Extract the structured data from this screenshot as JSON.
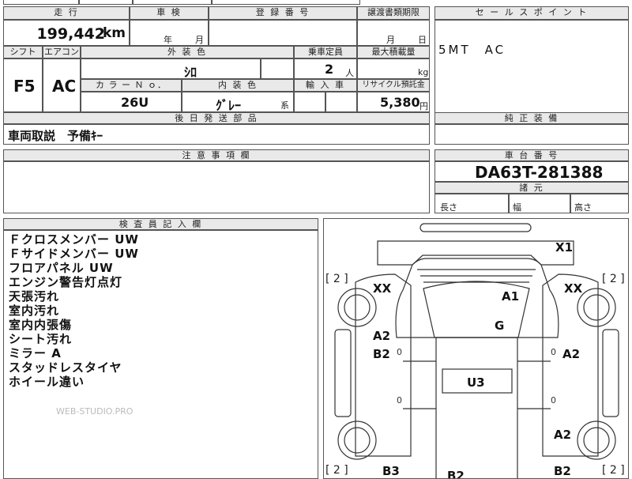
{
  "top_strip": {
    "partial_text": "…"
  },
  "mileage": {
    "header": "走 行",
    "value": "199,442",
    "unit": "km"
  },
  "inspection": {
    "header": "車 検",
    "year_unit": "年",
    "month_unit": "月"
  },
  "registration": {
    "header": "登 録 番 号",
    "value": ""
  },
  "transfer_deadline": {
    "header": "譲渡書類期限",
    "month_unit": "月",
    "day_unit": "日"
  },
  "sales_point": {
    "header": "セ ー ル ス ポ イ ン ト",
    "text": "5MT　AC"
  },
  "shift": {
    "header": "シフト",
    "value": "F5"
  },
  "aircon": {
    "header": "エアコン",
    "value": "AC"
  },
  "exterior": {
    "header": "外 装 色",
    "value": "ｼﾛ"
  },
  "capacity": {
    "header": "乗車定員",
    "value": "2",
    "unit": "人"
  },
  "max_load": {
    "header": "最大積載量",
    "value": "",
    "unit": "kg"
  },
  "color_no": {
    "header": "カ ラ ー Ｎ ｏ．",
    "value": "26U"
  },
  "interior": {
    "header": "内 装 色",
    "value": "ｸﾞﾚｰ",
    "suffix": "系"
  },
  "import": {
    "header": "輸 入 車",
    "value": ""
  },
  "recycle": {
    "header": "リサイクル預託金",
    "value": "5,380",
    "unit": "円"
  },
  "later_parts": {
    "header": "後 日 発 送 部 品",
    "value": "車両取説　予備ｷｰ"
  },
  "genuine_equipment": {
    "header": "純 正 装 備",
    "value": ""
  },
  "notes": {
    "header": "注 意 事 項 欄",
    "value": ""
  },
  "chassis": {
    "header": "車 台 番 号",
    "value": "DA63T-281388"
  },
  "dimensions": {
    "header": "諸 元",
    "length_label": "長さ",
    "width_label": "幅",
    "height_label": "高さ"
  },
  "inspector": {
    "header": "検 査 員 記 入 欄",
    "items": [
      "Ｆクロスメンバー UW",
      "Ｆサイドメンバー UW",
      "フロアパネル UW",
      "エンジン警告灯点灯",
      "天張汚れ",
      "室内汚れ",
      "室内内張傷",
      "シート汚れ",
      "ミラー A",
      "スタッドレスタイヤ",
      "ホイール違い"
    ],
    "watermark": "WEB-STUDIO.PRO"
  },
  "diagram": {
    "labels": {
      "x1": "X1",
      "xx_left": "XX",
      "xx_right": "XX",
      "a1": "A1",
      "g": "G",
      "a2_left": "A2",
      "b2_left": "B2",
      "a2_right": "A2",
      "u3": "U3",
      "a2_rear_right": "A2",
      "b3": "B3",
      "b2_right_bottom": "B2",
      "b2_bottom_center": "B2",
      "tick": "0"
    },
    "bracket_tl": "[ 2 ]",
    "bracket_tr": "[ 2 ]",
    "bracket_bl": "[ 2 ]",
    "bracket_br": "[ 2 ]"
  }
}
